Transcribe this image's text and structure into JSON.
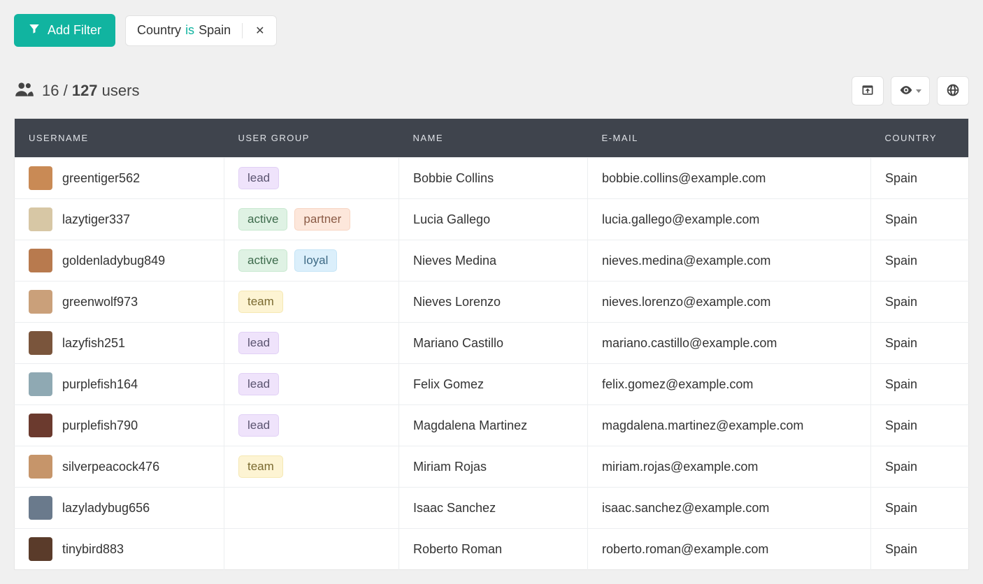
{
  "filter_bar": {
    "add_filter_label": "Add Filter",
    "chip": {
      "field": "Country",
      "op": "is",
      "value": "Spain"
    }
  },
  "summary": {
    "filtered": "16",
    "sep": " / ",
    "total": "127",
    "unit": " users"
  },
  "columns": {
    "username": "Username",
    "group": "User Group",
    "name": "Name",
    "email": "E-Mail",
    "country": "Country"
  },
  "tag_labels": {
    "lead": "lead",
    "active": "active",
    "partner": "partner",
    "loyal": "loyal",
    "team": "team"
  },
  "rows": [
    {
      "username": "greentiger562",
      "groups": [
        "lead"
      ],
      "name": "Bobbie Collins",
      "email": "bobbie.collins@example.com",
      "country": "Spain",
      "avatar": "#c98a55"
    },
    {
      "username": "lazytiger337",
      "groups": [
        "active",
        "partner"
      ],
      "name": "Lucia Gallego",
      "email": "lucia.gallego@example.com",
      "country": "Spain",
      "avatar": "#d7c7a5"
    },
    {
      "username": "goldenladybug849",
      "groups": [
        "active",
        "loyal"
      ],
      "name": "Nieves Medina",
      "email": "nieves.medina@example.com",
      "country": "Spain",
      "avatar": "#b87a4e"
    },
    {
      "username": "greenwolf973",
      "groups": [
        "team"
      ],
      "name": "Nieves Lorenzo",
      "email": "nieves.lorenzo@example.com",
      "country": "Spain",
      "avatar": "#caa07a"
    },
    {
      "username": "lazyfish251",
      "groups": [
        "lead"
      ],
      "name": "Mariano Castillo",
      "email": "mariano.castillo@example.com",
      "country": "Spain",
      "avatar": "#7a553c"
    },
    {
      "username": "purplefish164",
      "groups": [
        "lead"
      ],
      "name": "Felix Gomez",
      "email": "felix.gomez@example.com",
      "country": "Spain",
      "avatar": "#8fa9b3"
    },
    {
      "username": "purplefish790",
      "groups": [
        "lead"
      ],
      "name": "Magdalena Martinez",
      "email": "magdalena.martinez@example.com",
      "country": "Spain",
      "avatar": "#6b3a2e"
    },
    {
      "username": "silverpeacock476",
      "groups": [
        "team"
      ],
      "name": "Miriam Rojas",
      "email": "miriam.rojas@example.com",
      "country": "Spain",
      "avatar": "#c6956a"
    },
    {
      "username": "lazyladybug656",
      "groups": [],
      "name": "Isaac Sanchez",
      "email": "isaac.sanchez@example.com",
      "country": "Spain",
      "avatar": "#6a7a8c"
    },
    {
      "username": "tinybird883",
      "groups": [],
      "name": "Roberto Roman",
      "email": "roberto.roman@example.com",
      "country": "Spain",
      "avatar": "#5a3b2a"
    }
  ]
}
